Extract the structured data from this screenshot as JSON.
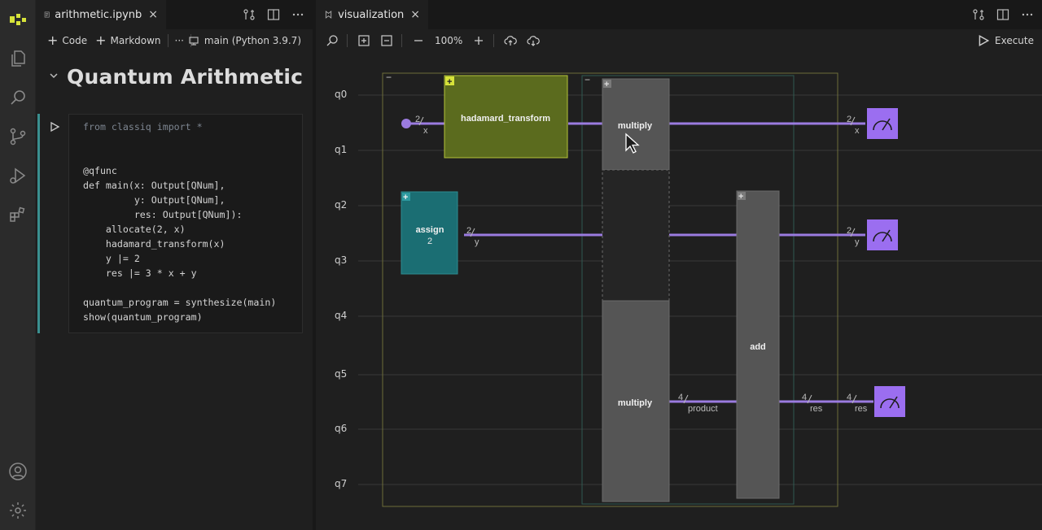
{
  "colors": {
    "wire": "#9b7be0",
    "measure": "#9b6ef0",
    "hadamard": "#5b6b1e",
    "assign": "#1b6e73",
    "gate_gray": "#4a4a4a"
  },
  "activity_icons": [
    "classiq-logo-icon",
    "files-icon",
    "search-icon",
    "source-control-icon",
    "run-debug-icon",
    "extensions-icon",
    "account-icon",
    "settings-gear-icon"
  ],
  "left_tab": {
    "title": "arithmetic.ipynb",
    "close": "×"
  },
  "nb_toolbar": {
    "code": "Code",
    "markdown": "Markdown",
    "more": "···",
    "kernel": "main (Python 3.9.7)"
  },
  "notebook": {
    "chevron": "⌄",
    "heading": "Quantum Arithmetic",
    "code": [
      "from classiq import *",
      "",
      "",
      "@qfunc",
      "def main(x: Output[QNum],",
      "         y: Output[QNum],",
      "         res: Output[QNum]):",
      "    allocate(2, x)",
      "    hadamard_transform(x)",
      "    y |= 2",
      "    res |= 3 * x + y",
      "",
      "quantum_program = synthesize(main)",
      "show(quantum_program)"
    ]
  },
  "right_tab": {
    "title": "visualization",
    "close": "×"
  },
  "vz_toolbar": {
    "zoom": "100%",
    "execute": "Execute"
  },
  "circuit": {
    "qubits": [
      "q0",
      "q1",
      "q2",
      "q3",
      "q4",
      "q5",
      "q6",
      "q7"
    ],
    "gates": {
      "hadamard": "hadamard_transform",
      "assign": "assign",
      "assign_value": "2",
      "multiply_top": "multiply",
      "multiply_bottom": "multiply",
      "add": "add"
    },
    "wire_labels": {
      "x_in_count": "2",
      "x_in_name": "x",
      "x_out_count": "2",
      "x_out_name": "x",
      "y_in_count": "2",
      "y_in_name": "y",
      "y_out_count": "2",
      "y_out_name": "y",
      "product_count": "4",
      "product_name": "product",
      "res_mid_count": "4",
      "res_mid_name": "res",
      "res_out_count": "4",
      "res_out_name": "res"
    },
    "box_markers": {
      "collapse": "−",
      "expand": "+"
    }
  }
}
